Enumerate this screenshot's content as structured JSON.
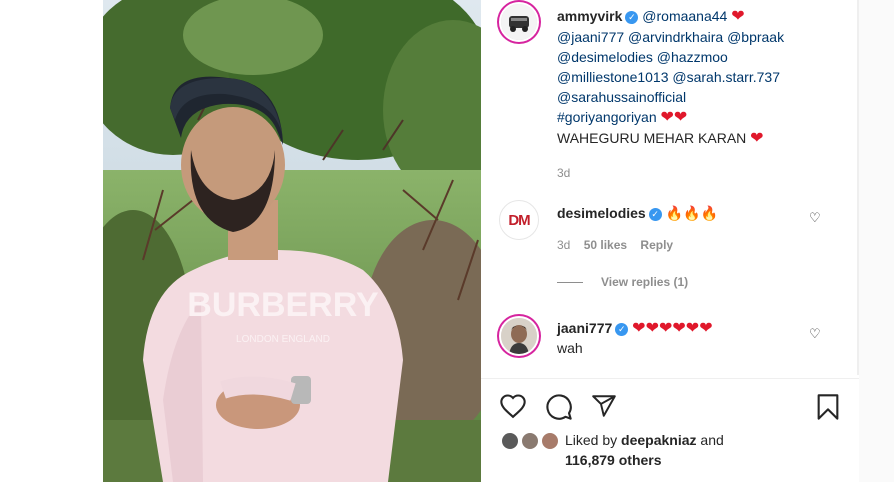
{
  "post": {
    "author": "ammyvirk",
    "caption_mentions_line1": "@romaana44",
    "caption_lines": [
      "@jaani777 @arvindrkhaira @bpraak",
      "@desimelodies @hazzmoo",
      "@milliestone1013 @sarah.starr.737",
      "@sarahussainofficial",
      "#goriyangoriyan"
    ],
    "caption_last_line": "WAHEGURU MEHAR KARAN",
    "time": "3d",
    "media_text": "BURBERRY",
    "media_subtext": "LONDON ENGLAND"
  },
  "comments": [
    {
      "avatar_text": "DM",
      "username": "desimelodies",
      "emoji": "🔥🔥🔥",
      "time": "3d",
      "likes": "50 likes",
      "reply_label": "Reply",
      "view_replies": "View replies (1)"
    },
    {
      "username": "jaani777",
      "text": "wah",
      "hearts": "❤❤❤❤❤❤"
    }
  ],
  "likes": {
    "prefix": "Liked by",
    "user": "deepakniaz",
    "and": "and",
    "others": "116,879 others"
  },
  "icons": {
    "heart": "heart-icon",
    "comment": "comment-icon",
    "share": "share-icon",
    "save": "bookmark-icon"
  },
  "colors": {
    "mention": "#00376b",
    "verified": "#3897f0",
    "heart": "#e0182b",
    "muted": "#8e8e8e"
  }
}
